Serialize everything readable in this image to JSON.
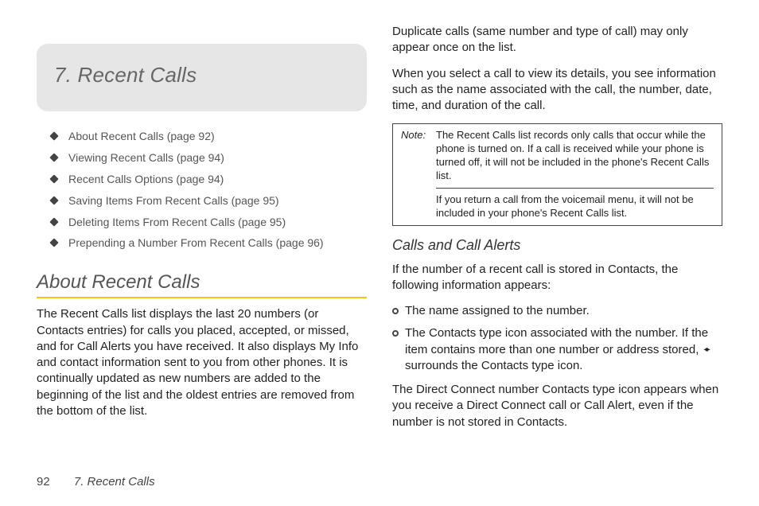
{
  "chapter": {
    "title": "7.   Recent Calls"
  },
  "toc": {
    "items": [
      {
        "text": "About Recent Calls (page 92)"
      },
      {
        "text": "Viewing Recent Calls (page 94)"
      },
      {
        "text": "Recent Calls Options (page 94)"
      },
      {
        "text": "Saving Items From Recent Calls (page 95)"
      },
      {
        "text": "Deleting Items From Recent Calls (page 95)"
      },
      {
        "text": "Prepending a Number From Recent Calls (page 96)"
      }
    ]
  },
  "section1": {
    "heading": "About Recent Calls",
    "para": "The Recent Calls list displays the last 20 numbers (or Contacts entries) for calls you placed, accepted, or missed, and for Call Alerts you have received. It also displays My Info and contact information sent to you from other phones. It is continually updated as new numbers are added to the beginning of the list and the oldest entries are removed from the bottom of the list."
  },
  "right": {
    "para1": "Duplicate calls (same number and type of call) may only appear once on the list.",
    "para2": "When you select a call to view its details, you see information such as the name associated with the call, the number, date, time, and duration of the call."
  },
  "note": {
    "label": "Note:",
    "body1": "The Recent Calls list records only calls that occur while the phone is turned on. If a call is received while your phone is turned off, it will not be included in the phone's Recent Calls list.",
    "body2": "If you return a call from the voicemail menu, it will not be included in your phone's Recent Calls list."
  },
  "subsection": {
    "heading": "Calls and Call Alerts",
    "intro": "If the number of a recent call is stored in Contacts, the following information appears:",
    "bullets": {
      "b1": "The name assigned to the number.",
      "b2a": "The Contacts type icon associated with the number. If the item contains more than one number or address stored,",
      "b2b": "surrounds the Contacts type icon."
    },
    "closing": "The Direct Connect number Contacts type icon appears when you receive a Direct Connect call or Call Alert, even if the number is not stored in Contacts."
  },
  "footer": {
    "page_number": "92",
    "running": "7. Recent Calls"
  },
  "arrows_glyph": "◂▸"
}
